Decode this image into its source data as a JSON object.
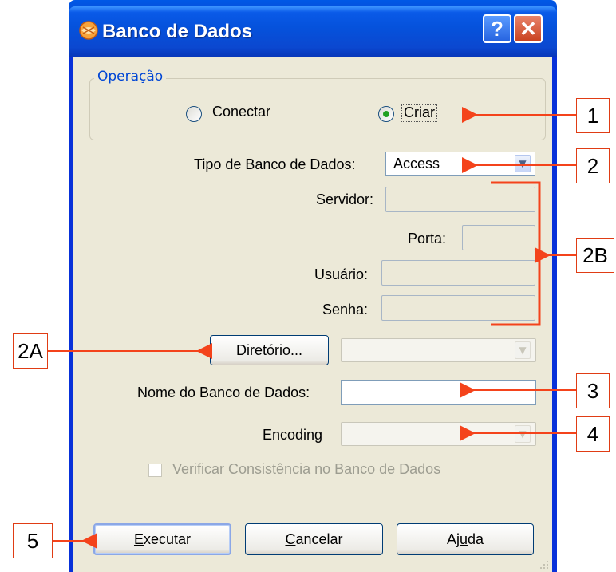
{
  "window": {
    "title": "Banco de Dados",
    "help_glyph": "?",
    "close_glyph": "✕",
    "icon": "database-app-icon"
  },
  "group": {
    "legend": "Operação",
    "options": [
      {
        "label": "Conectar",
        "selected": false
      },
      {
        "label": "Criar",
        "selected": true
      }
    ]
  },
  "form": {
    "db_type_label": "Tipo de Banco de Dados:",
    "db_type_value": "Access",
    "server_label": "Servidor:",
    "port_label": "Porta:",
    "user_label": "Usuário:",
    "password_label": "Senha:",
    "directory_button": "Diretório...",
    "db_name_label": "Nome do Banco de Dados:",
    "encoding_label": "Encoding",
    "verify_label": "Verificar Consistência no Banco de Dados"
  },
  "buttons": {
    "execute": "Executar",
    "execute_key": "E",
    "execute_rest": "xecutar",
    "cancel_key": "C",
    "cancel_rest": "ancelar",
    "help_pre": "Aj",
    "help_key": "u",
    "help_rest": "da"
  },
  "annotations": {
    "a1": "1",
    "a2": "2",
    "a2b": "2B",
    "a2a": "2A",
    "a3": "3",
    "a4": "4",
    "a5": "5"
  },
  "colors": {
    "annotation": "#f4431b",
    "titlebar": "#0552dc",
    "dialog_bg": "#ece9d8"
  }
}
